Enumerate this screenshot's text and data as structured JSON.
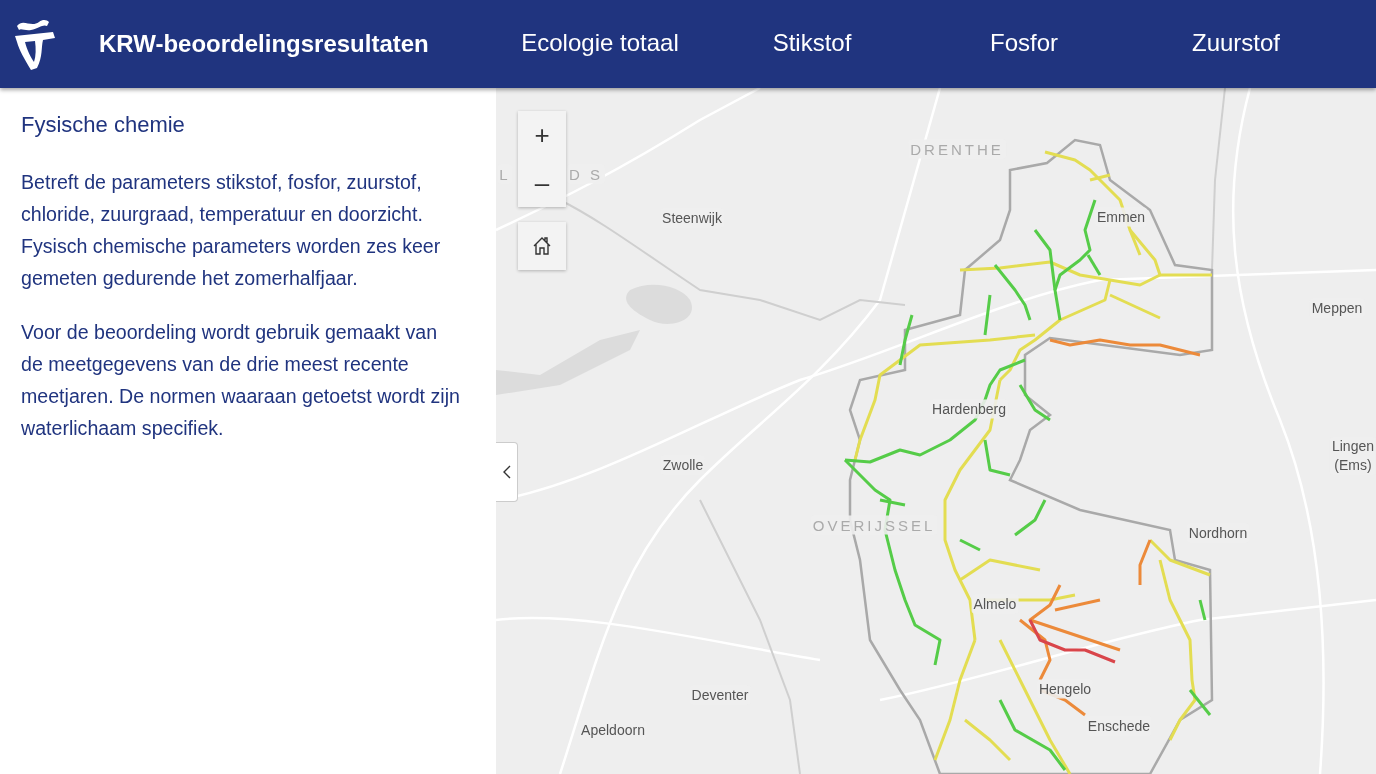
{
  "header": {
    "title": "KRW-beoordelingsresultaten",
    "tabs": [
      {
        "label": "Ecologie totaal",
        "selected": false
      },
      {
        "label": "Stikstof",
        "selected": false
      },
      {
        "label": "Fosfor",
        "selected": false
      },
      {
        "label": "Zuurstof",
        "selected": false
      }
    ]
  },
  "sidebar": {
    "heading": "Fysische chemie",
    "paragraphs": [
      "Betreft de parameters stikstof, fosfor, zuurstof, chloride, zuurgraad, temperatuur en doorzicht. Fysisch chemische parameters worden zes keer gemeten gedurende het zomerhalfjaar.",
      "Voor de beoordeling wordt gebruik gemaakt van de meetgegevens van de drie meest recente meetjaren. De normen waaraan getoetst wordt zijn waterlichaam specifiek."
    ]
  },
  "map": {
    "zoom_in": "+",
    "zoom_out": "–",
    "labels": [
      {
        "text": "DRENTHE",
        "kind": "region"
      },
      {
        "text": "L",
        "kind": "region"
      },
      {
        "text": "D S",
        "kind": "region"
      },
      {
        "text": "Steenwijk",
        "kind": "place"
      },
      {
        "text": "Emmen",
        "kind": "place"
      },
      {
        "text": "Meppen",
        "kind": "place"
      },
      {
        "text": "Hardenberg",
        "kind": "place"
      },
      {
        "text": "Zwolle",
        "kind": "place"
      },
      {
        "text": "Lingen\n(Ems)",
        "kind": "place"
      },
      {
        "text": "OVERIJSSEL",
        "kind": "region"
      },
      {
        "text": "Nordhorn",
        "kind": "place"
      },
      {
        "text": "Almelo",
        "kind": "place"
      },
      {
        "text": "Hengelo",
        "kind": "place"
      },
      {
        "text": "Deventer",
        "kind": "place"
      },
      {
        "text": "Enschede",
        "kind": "place"
      },
      {
        "text": "Apeldoorn",
        "kind": "place"
      }
    ]
  }
}
